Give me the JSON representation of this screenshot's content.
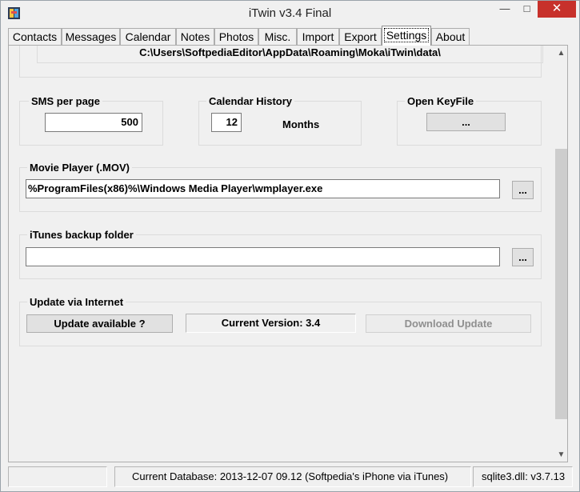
{
  "window": {
    "title": "iTwin v3.4 Final",
    "minimize_glyph": "—",
    "maximize_glyph": "□",
    "close_glyph": "✕"
  },
  "tabs": [
    {
      "label": "Contacts"
    },
    {
      "label": "Messages"
    },
    {
      "label": "Calendar"
    },
    {
      "label": "Notes"
    },
    {
      "label": "Photos"
    },
    {
      "label": "Misc."
    },
    {
      "label": "Import"
    },
    {
      "label": "Export"
    },
    {
      "label": "Settings",
      "active": true
    },
    {
      "label": "About"
    }
  ],
  "settings": {
    "data_path": "C:\\Users\\SoftpediaEditor\\AppData\\Roaming\\Moka\\iTwin\\data\\",
    "sms": {
      "label": "SMS per page",
      "value": "500"
    },
    "calendar": {
      "label": "Calendar History",
      "value": "12",
      "unit": "Months"
    },
    "keyfile": {
      "label": "Open KeyFile",
      "button": "..."
    },
    "movie": {
      "label": "Movie Player  (.MOV)",
      "value": "%ProgramFiles(x86)%\\Windows Media Player\\wmplayer.exe",
      "browse": "..."
    },
    "itunes": {
      "label": "iTunes backup folder",
      "value": "",
      "browse": "..."
    },
    "update": {
      "label": "Update via Internet",
      "check_button": "Update available ?",
      "current_version": "Current Version: 3.4",
      "download_button": "Download Update"
    }
  },
  "scrollbar": {
    "up": "▲",
    "down": "▼"
  },
  "status": {
    "database": "Current Database: 2013-12-07  09.12  (Softpedia's iPhone via iTunes)",
    "sqlite": "sqlite3.dll: v3.7.13"
  },
  "colors": {
    "close_button": "#c7312b",
    "window_bg": "#f0f0f0"
  }
}
